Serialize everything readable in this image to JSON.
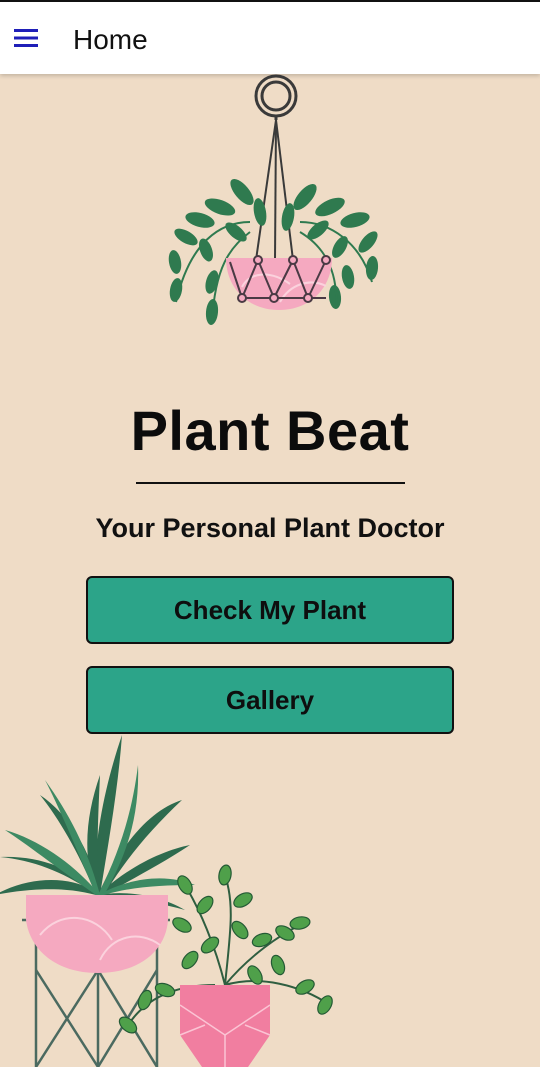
{
  "appbar": {
    "title": "Home",
    "menu_icon": "hamburger-menu-icon",
    "icon_color": "#1f1fb8"
  },
  "hero": {
    "title": "Plant Beat",
    "subtitle": "Your Personal Plant Doctor"
  },
  "actions": {
    "check_label": "Check My Plant",
    "gallery_label": "Gallery"
  },
  "colors": {
    "background": "#efdcc6",
    "button": "#2ca489",
    "pot_pink": "#f5a9c0",
    "leaf_green": "#2f7a4f"
  },
  "illustrations": [
    "hanging-plant-illustration",
    "potted-plants-illustration"
  ]
}
